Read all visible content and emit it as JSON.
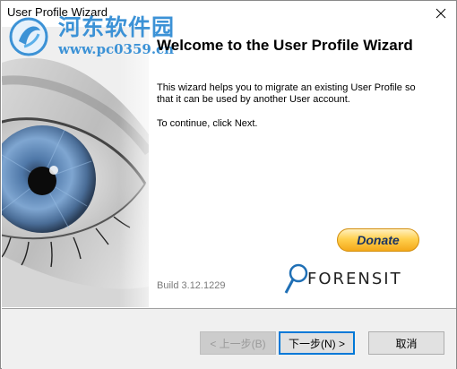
{
  "window": {
    "title": "User Profile Wizard"
  },
  "watermark": {
    "site_name": "河东软件园",
    "url": "www.pc0359.cn"
  },
  "content": {
    "heading": "Welcome to the User Profile Wizard",
    "description": "This wizard helps you to migrate an existing User Profile so that it can be used by another User account.",
    "continue_text": "To continue, click Next.",
    "donate_label": "Donate",
    "build": "Build 3.12.1229",
    "brand_name": "FORENSIT"
  },
  "buttons": {
    "back": "< 上一步(B)",
    "next": "下一步(N) >",
    "cancel": "取消"
  },
  "colors": {
    "accent": "#0078d7",
    "watermark": "#3c92d6",
    "donate_text": "#1a3463",
    "donate_fill": "#ffd04f",
    "brand_accent": "#1f6fb5"
  },
  "icons": {
    "close": "close-icon",
    "watermark_logo": "watermark-logo-icon",
    "eye": "eye-image",
    "brand": "magnifier-logo-icon"
  }
}
